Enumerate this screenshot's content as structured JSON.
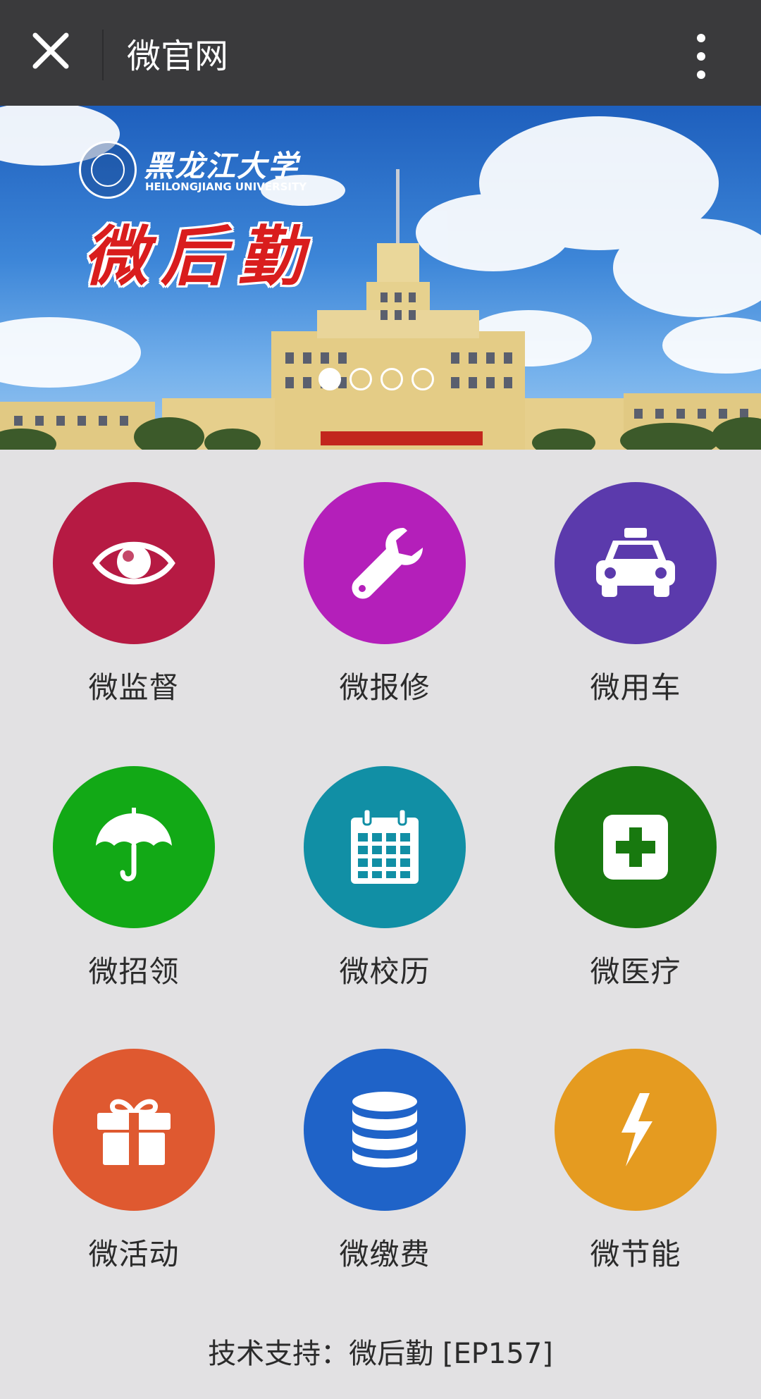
{
  "header": {
    "title": "微官网",
    "close_icon": "close-icon",
    "more_icon": "more-vertical-icon"
  },
  "banner": {
    "logo_cn": "黑龙江大学",
    "logo_en": "HEILONGJIANG UNIVERSITY",
    "slogan": "微后勤",
    "slide_count": 4,
    "active_slide": 1
  },
  "tiles": [
    {
      "label": "微监督",
      "icon": "eye-icon",
      "color": "#b61a43"
    },
    {
      "label": "微报修",
      "icon": "wrench-icon",
      "color": "#b41fba"
    },
    {
      "label": "微用车",
      "icon": "taxi-icon",
      "color": "#5b3aac"
    },
    {
      "label": "微招领",
      "icon": "umbrella-icon",
      "color": "#12a916"
    },
    {
      "label": "微校历",
      "icon": "calendar-icon",
      "color": "#118fa5"
    },
    {
      "label": "微医疗",
      "icon": "medical-kit-icon",
      "color": "#18790f"
    },
    {
      "label": "微活动",
      "icon": "gift-icon",
      "color": "#df5930"
    },
    {
      "label": "微缴费",
      "icon": "database-icon",
      "color": "#1f63c8"
    },
    {
      "label": "微节能",
      "icon": "lightning-icon",
      "color": "#e59b20"
    }
  ],
  "footer": {
    "text": "技术支持：微后勤 [EP157]"
  }
}
